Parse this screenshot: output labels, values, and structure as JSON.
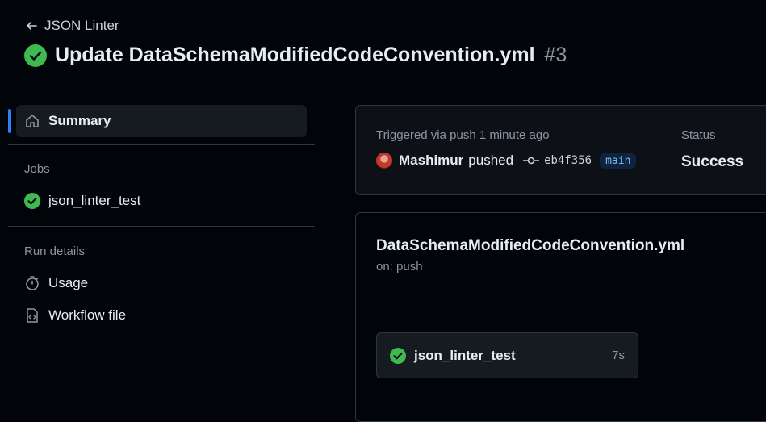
{
  "header": {
    "back_label": "JSON Linter",
    "title": "Update DataSchemaModifiedCodeConvention.yml",
    "run_number": "#3"
  },
  "sidebar": {
    "summary_label": "Summary",
    "jobs_heading": "Jobs",
    "jobs": [
      {
        "label": "json_linter_test"
      }
    ],
    "run_details_heading": "Run details",
    "details": [
      {
        "label": "Usage"
      },
      {
        "label": "Workflow file"
      }
    ]
  },
  "summary_card": {
    "triggered_text": "Triggered via push 1 minute ago",
    "user": "Mashimur",
    "action": "pushed",
    "commit_sha": "eb4f356",
    "branch": "main",
    "status_label": "Status",
    "status_value": "Success"
  },
  "workflow_card": {
    "file_name": "DataSchemaModifiedCodeConvention.yml",
    "trigger": "on: push",
    "job": {
      "name": "json_linter_test",
      "duration": "7s"
    }
  },
  "colors": {
    "success_green": "#3fb950",
    "accent_blue": "#2f81f7",
    "background": "#010409"
  }
}
